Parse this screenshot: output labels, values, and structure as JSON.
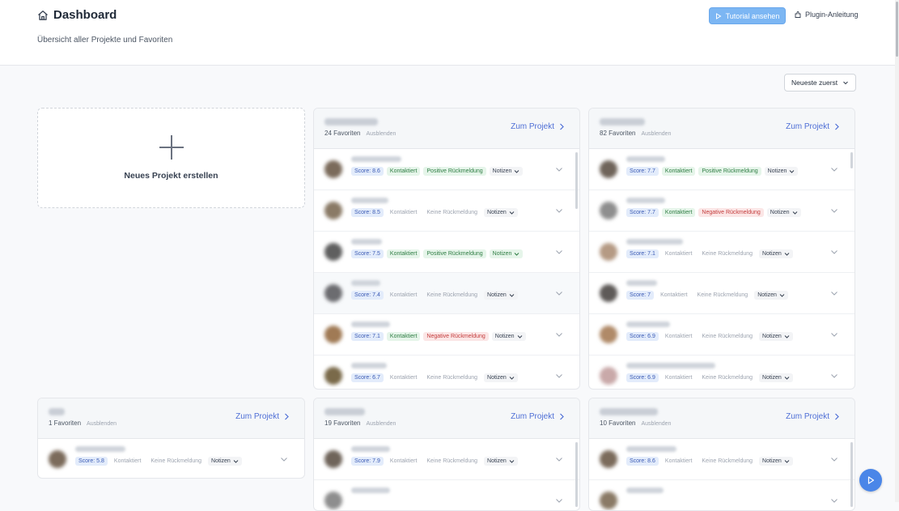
{
  "header": {
    "title": "Dashboard",
    "subtitle": "Übersicht aller Projekte und Favoriten",
    "tutorial_label": "Tutorial ansehen",
    "plugin_label": "Plugin-Anleitung"
  },
  "sort": {
    "selected": "Neueste zuerst"
  },
  "new_project_label": "Neues Projekt erstellen",
  "labels": {
    "zum_projekt": "Zum Projekt",
    "ausblenden": "Ausblenden"
  },
  "colors": {
    "accent": "#4f6fd6",
    "tutorial": "#7cb6f3",
    "fab": "#4a86e8"
  },
  "projects": [
    {
      "favorites": "24 Favoriten",
      "rows": [
        {
          "score": "Score: 8.6",
          "kontakt": "Kontaktiert",
          "kontakt_active": true,
          "feedback": "Positive Rückmeldung",
          "feedback_type": "pos",
          "notes": "Notizen",
          "notes_green": false
        },
        {
          "score": "Score: 8.5",
          "kontakt": "Kontaktiert",
          "kontakt_active": false,
          "feedback": "Keine Rückmeldung",
          "feedback_type": "none",
          "notes": "Notizen",
          "notes_green": false
        },
        {
          "score": "Score: 7.5",
          "kontakt": "Kontaktiert",
          "kontakt_active": true,
          "feedback": "Positive Rückmeldung",
          "feedback_type": "pos",
          "notes": "Notizen",
          "notes_green": true
        },
        {
          "score": "Score: 7.4",
          "kontakt": "Kontaktiert",
          "kontakt_active": false,
          "feedback": "Keine Rückmeldung",
          "feedback_type": "none",
          "notes": "Notizen",
          "notes_green": false
        },
        {
          "score": "Score: 7.1",
          "kontakt": "Kontaktiert",
          "kontakt_active": true,
          "feedback": "Negative Rückmeldung",
          "feedback_type": "neg",
          "notes": "Notizen",
          "notes_green": false
        },
        {
          "score": "Score: 6.7",
          "kontakt": "Kontaktiert",
          "kontakt_active": false,
          "feedback": "Keine Rückmeldung",
          "feedback_type": "none",
          "notes": "Notizen",
          "notes_green": false
        }
      ]
    },
    {
      "favorites": "82 Favoriten",
      "rows": [
        {
          "score": "Score: 7.7",
          "kontakt": "Kontaktiert",
          "kontakt_active": true,
          "feedback": "Positive Rückmeldung",
          "feedback_type": "pos",
          "notes": "Notizen",
          "notes_green": false
        },
        {
          "score": "Score: 7.7",
          "kontakt": "Kontaktiert",
          "kontakt_active": true,
          "feedback": "Negative Rückmeldung",
          "feedback_type": "neg",
          "notes": "Notizen",
          "notes_green": false
        },
        {
          "score": "Score: 7.1",
          "kontakt": "Kontaktiert",
          "kontakt_active": false,
          "feedback": "Keine Rückmeldung",
          "feedback_type": "none",
          "notes": "Notizen",
          "notes_green": false
        },
        {
          "score": "Score: 7",
          "kontakt": "Kontaktiert",
          "kontakt_active": false,
          "feedback": "Keine Rückmeldung",
          "feedback_type": "none",
          "notes": "Notizen",
          "notes_green": false
        },
        {
          "score": "Score: 6.9",
          "kontakt": "Kontaktiert",
          "kontakt_active": false,
          "feedback": "Keine Rückmeldung",
          "feedback_type": "none",
          "notes": "Notizen",
          "notes_green": false
        },
        {
          "score": "Score: 6.9",
          "kontakt": "Kontaktiert",
          "kontakt_active": false,
          "feedback": "Keine Rückmeldung",
          "feedback_type": "none",
          "notes": "Notizen",
          "notes_green": false
        }
      ]
    },
    {
      "favorites": "1 Favoriten",
      "rows": [
        {
          "score": "Score: 5.8",
          "kontakt": "Kontaktiert",
          "kontakt_active": false,
          "feedback": "Keine Rückmeldung",
          "feedback_type": "none",
          "notes": "Notizen",
          "notes_green": false
        }
      ]
    },
    {
      "favorites": "19 Favoriten",
      "rows": [
        {
          "score": "Score: 7.9",
          "kontakt": "Kontaktiert",
          "kontakt_active": false,
          "feedback": "Keine Rückmeldung",
          "feedback_type": "none",
          "notes": "Notizen",
          "notes_green": false
        }
      ]
    },
    {
      "favorites": "10 Favoriten",
      "rows": [
        {
          "score": "Score: 8.6",
          "kontakt": "Kontaktiert",
          "kontakt_active": false,
          "feedback": "Keine Rückmeldung",
          "feedback_type": "none",
          "notes": "Notizen",
          "notes_green": false
        }
      ]
    }
  ]
}
